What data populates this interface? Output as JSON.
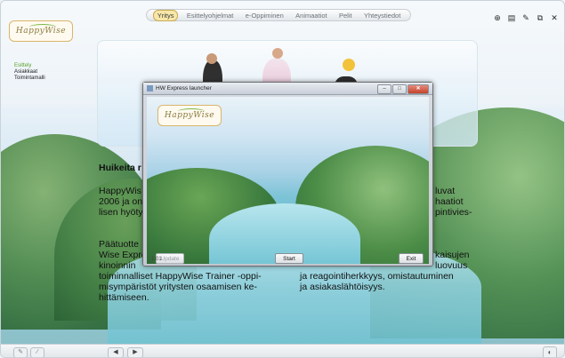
{
  "app": {
    "logo_text": "HappyWise"
  },
  "nav": {
    "tabs": [
      {
        "label": "Yritys",
        "active": true
      },
      {
        "label": "Esittelyohjelmat",
        "active": false
      },
      {
        "label": "e-Oppiminen",
        "active": false
      },
      {
        "label": "Animaatiot",
        "active": false
      },
      {
        "label": "Pelit",
        "active": false
      },
      {
        "label": "Yhteystiedot",
        "active": false
      }
    ]
  },
  "toolbar": {
    "icons": [
      "settings-icon",
      "print-icon",
      "edit-icon",
      "window-icon",
      "close-icon"
    ],
    "glyphs": [
      "⊕",
      "▤",
      "✎",
      "⧉",
      "✕"
    ]
  },
  "sidebar": {
    "items": [
      {
        "label": "Esittely",
        "active": true
      },
      {
        "label": "Asiakkaat",
        "active": false
      },
      {
        "label": "Toimintamalli",
        "active": false
      }
    ]
  },
  "content": {
    "heading": "Huikeita r",
    "left_col_1": [
      "HappyWis",
      "2006 ja on",
      "lisen hyöty"
    ],
    "left_col_2": [
      "Päätuotte",
      "Wise Expre",
      "kinoinnin"
    ],
    "left_col_full": [
      "toiminnalliset HappyWise Trainer -oppi-",
      "misympäristöt yritysten osaamisen ke-",
      "hittämiseen."
    ],
    "right_col_1": [
      "luvat",
      "haatiot",
      "pintivies-"
    ],
    "right_col_2": [
      "kaisujen",
      "luovuus"
    ],
    "right_col_full": [
      "ja reagointiherkkyys, omistautuminen",
      "ja asiakaslähtöisyys."
    ]
  },
  "launcher": {
    "title": "HW Express launcher",
    "logo_text": "HappyWise",
    "buttons": {
      "update": "Update",
      "start": "Start",
      "exit": "Exit"
    },
    "version": "1.01"
  },
  "bottom": {
    "prev": "◀",
    "next": "▶",
    "left_icons": [
      "✎",
      "⁄"
    ],
    "right_icon": "◐"
  }
}
